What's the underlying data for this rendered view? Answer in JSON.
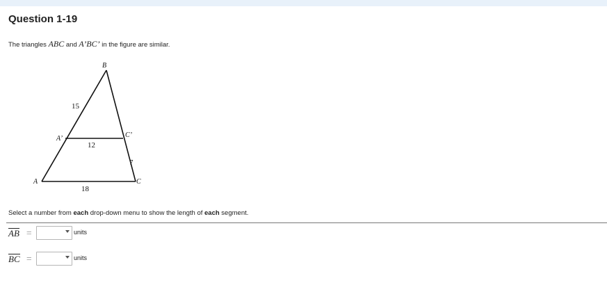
{
  "header": {
    "title": "Question 1-19"
  },
  "prompt": {
    "text_before": "The triangles ",
    "tri1": "ABC",
    "text_mid": " and ",
    "tri2": "A’BC’",
    "text_after": " in the figure are similar."
  },
  "figure": {
    "labels": {
      "B": "B",
      "A_prime": "A’",
      "C_prime": "C’",
      "A": "A",
      "C": "C"
    },
    "lengths": {
      "BA_prime": "15",
      "A_primeC_prime": "12",
      "C_primeC": "7",
      "AC": "18"
    }
  },
  "instruction": {
    "text1": "Select a number from ",
    "bold1": "each",
    "text2": " drop-down menu to show the length of ",
    "bold2": "each",
    "text3": " segment."
  },
  "answers": [
    {
      "segment": "AB",
      "equals": "=",
      "value": "",
      "units": "units"
    },
    {
      "segment": "BC",
      "equals": "=",
      "value": "",
      "units": "units"
    }
  ]
}
